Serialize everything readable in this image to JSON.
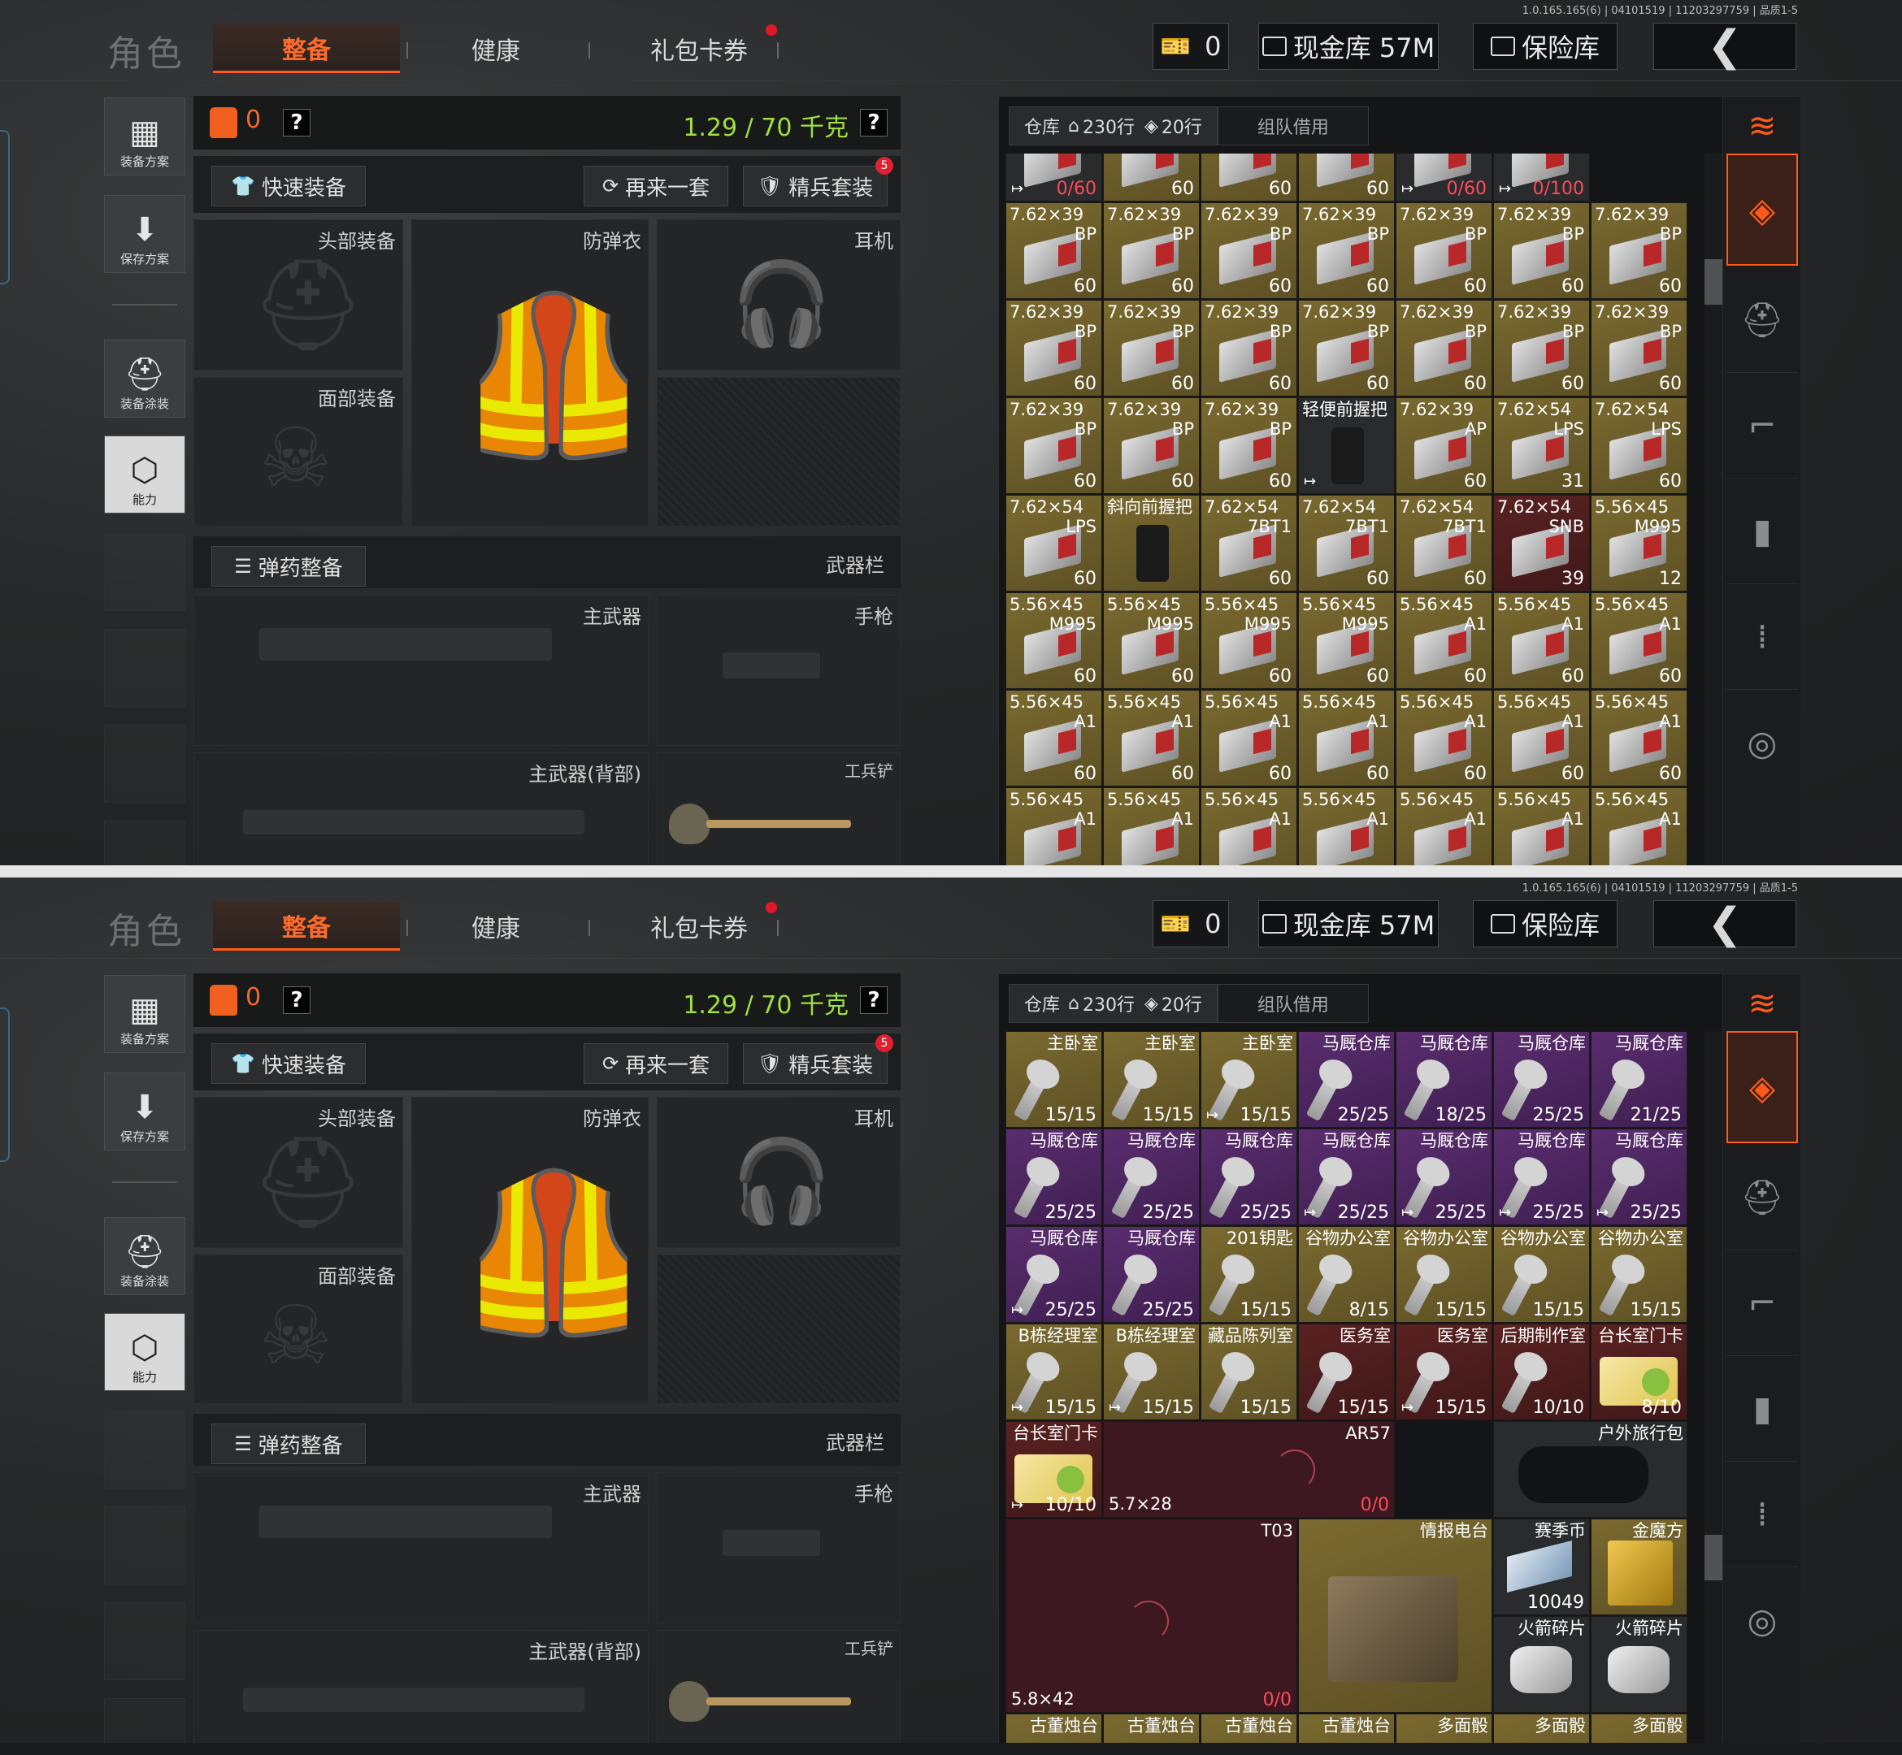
{
  "version": "1.0.165.165(6) | 04101519 | 11203297759 | 品质1-5",
  "nav": {
    "role": "角色",
    "tabs": [
      "整备",
      "健康",
      "礼包卡券"
    ]
  },
  "header": {
    "ticket_count": "0",
    "cash_label": "现金库 57M",
    "safe_label": "保险库",
    "back_icon": "back-arrow-icon"
  },
  "left_nav": {
    "items": [
      "装备方案",
      "保存方案",
      "装备涂装",
      "能力"
    ]
  },
  "equip": {
    "vest_count": "0",
    "weight": "1.29 / 70 千克",
    "quick_equip": "快速装备",
    "retry": "再来一套",
    "elite": "精兵套装",
    "elite_badge": "5",
    "slots": {
      "head": "头部装备",
      "armor": "防弹衣",
      "ear": "耳机",
      "face": "面部装备"
    },
    "ammo_label": "弹药整备",
    "weapon_bar": "武器栏",
    "weapon_slots": {
      "primary": "主武器",
      "pistol": "手枪",
      "primary_back": "主武器(背部)",
      "melee": "工兵铲"
    }
  },
  "inventory": {
    "tab_warehouse": "仓库",
    "rows_home": "230行",
    "rows_extra": "20行",
    "tab_team": "组队借用",
    "colors": {
      "accent": "#ff5a1a",
      "green": "#9fe040",
      "red": "#ff4a5a"
    }
  },
  "grid1": [
    {
      "r": 0,
      "c": 0,
      "nm": "",
      "sub": "",
      "cnt": "0/60",
      "bg": "dark",
      "red": true,
      "mk": "↦",
      "ico": "box"
    },
    {
      "r": 0,
      "c": 1,
      "nm": "",
      "sub": "",
      "cnt": "60",
      "bg": "gold",
      "ico": "box"
    },
    {
      "r": 0,
      "c": 2,
      "nm": "",
      "sub": "",
      "cnt": "60",
      "bg": "gold",
      "ico": "box"
    },
    {
      "r": 0,
      "c": 3,
      "nm": "",
      "sub": "",
      "cnt": "60",
      "bg": "gold",
      "ico": "box"
    },
    {
      "r": 0,
      "c": 4,
      "nm": "",
      "sub": "",
      "cnt": "0/60",
      "bg": "dark",
      "red": true,
      "mk": "↦",
      "ico": "box"
    },
    {
      "r": 0,
      "c": 5,
      "nm": "",
      "sub": "",
      "cnt": "0/100",
      "bg": "dark",
      "red": true,
      "mk": "↦",
      "ico": "box"
    },
    {
      "r": 1,
      "c": 0,
      "nm": "7.62×39",
      "sub": "BP",
      "cnt": "60",
      "bg": "gold",
      "ico": "box"
    },
    {
      "r": 1,
      "c": 1,
      "nm": "7.62×39",
      "sub": "BP",
      "cnt": "60",
      "bg": "gold",
      "ico": "box"
    },
    {
      "r": 1,
      "c": 2,
      "nm": "7.62×39",
      "sub": "BP",
      "cnt": "60",
      "bg": "gold",
      "ico": "box"
    },
    {
      "r": 1,
      "c": 3,
      "nm": "7.62×39",
      "sub": "BP",
      "cnt": "60",
      "bg": "gold",
      "ico": "box"
    },
    {
      "r": 1,
      "c": 4,
      "nm": "7.62×39",
      "sub": "BP",
      "cnt": "60",
      "bg": "gold",
      "ico": "box"
    },
    {
      "r": 1,
      "c": 5,
      "nm": "7.62×39",
      "sub": "BP",
      "cnt": "60",
      "bg": "gold",
      "ico": "box"
    },
    {
      "r": 1,
      "c": 6,
      "nm": "7.62×39",
      "sub": "BP",
      "cnt": "60",
      "bg": "gold",
      "ico": "box"
    },
    {
      "r": 2,
      "c": 0,
      "nm": "7.62×39",
      "sub": "BP",
      "cnt": "60",
      "bg": "gold",
      "ico": "box"
    },
    {
      "r": 2,
      "c": 1,
      "nm": "7.62×39",
      "sub": "BP",
      "cnt": "60",
      "bg": "gold",
      "ico": "box"
    },
    {
      "r": 2,
      "c": 2,
      "nm": "7.62×39",
      "sub": "BP",
      "cnt": "60",
      "bg": "gold",
      "ico": "box"
    },
    {
      "r": 2,
      "c": 3,
      "nm": "7.62×39",
      "sub": "BP",
      "cnt": "60",
      "bg": "gold",
      "ico": "box"
    },
    {
      "r": 2,
      "c": 4,
      "nm": "7.62×39",
      "sub": "BP",
      "cnt": "60",
      "bg": "gold",
      "ico": "box"
    },
    {
      "r": 2,
      "c": 5,
      "nm": "7.62×39",
      "sub": "BP",
      "cnt": "60",
      "bg": "gold",
      "ico": "box"
    },
    {
      "r": 2,
      "c": 6,
      "nm": "7.62×39",
      "sub": "BP",
      "cnt": "60",
      "bg": "gold",
      "ico": "box"
    },
    {
      "r": 3,
      "c": 0,
      "nm": "7.62×39",
      "sub": "BP",
      "cnt": "60",
      "bg": "gold",
      "ico": "box"
    },
    {
      "r": 3,
      "c": 1,
      "nm": "7.62×39",
      "sub": "BP",
      "cnt": "60",
      "bg": "gold",
      "ico": "box"
    },
    {
      "r": 3,
      "c": 2,
      "nm": "7.62×39",
      "sub": "BP",
      "cnt": "60",
      "bg": "gold",
      "ico": "box"
    },
    {
      "r": 3,
      "c": 3,
      "nm": "轻便前握把",
      "sub": "",
      "cnt": "",
      "bg": "dark",
      "mk": "↦",
      "ico": "grip"
    },
    {
      "r": 3,
      "c": 4,
      "nm": "7.62×39",
      "sub": "AP",
      "cnt": "60",
      "bg": "gold",
      "ico": "box"
    },
    {
      "r": 3,
      "c": 5,
      "nm": "7.62×54",
      "sub": "LPS",
      "cnt": "31",
      "bg": "gold",
      "ico": "box"
    },
    {
      "r": 3,
      "c": 6,
      "nm": "7.62×54",
      "sub": "LPS",
      "cnt": "60",
      "bg": "gold",
      "ico": "box"
    },
    {
      "r": 4,
      "c": 0,
      "nm": "7.62×54",
      "sub": "LPS",
      "cnt": "60",
      "bg": "gold",
      "ico": "box"
    },
    {
      "r": 4,
      "c": 1,
      "nm": "斜向前握把",
      "sub": "",
      "cnt": "",
      "bg": "gold",
      "ico": "grip"
    },
    {
      "r": 4,
      "c": 2,
      "nm": "7.62×54",
      "sub": "7BT1",
      "cnt": "60",
      "bg": "gold",
      "ico": "box"
    },
    {
      "r": 4,
      "c": 3,
      "nm": "7.62×54",
      "sub": "7BT1",
      "cnt": "60",
      "bg": "gold",
      "ico": "box"
    },
    {
      "r": 4,
      "c": 4,
      "nm": "7.62×54",
      "sub": "7BT1",
      "cnt": "60",
      "bg": "gold",
      "ico": "box"
    },
    {
      "r": 4,
      "c": 5,
      "nm": "7.62×54",
      "sub": "SNB",
      "cnt": "39",
      "bg": "red",
      "ico": "box"
    },
    {
      "r": 4,
      "c": 6,
      "nm": "5.56×45",
      "sub": "M995",
      "cnt": "12",
      "bg": "gold",
      "ico": "box"
    },
    {
      "r": 5,
      "c": 0,
      "nm": "5.56×45",
      "sub": "M995",
      "cnt": "60",
      "bg": "gold",
      "ico": "box"
    },
    {
      "r": 5,
      "c": 1,
      "nm": "5.56×45",
      "sub": "M995",
      "cnt": "60",
      "bg": "gold",
      "ico": "box"
    },
    {
      "r": 5,
      "c": 2,
      "nm": "5.56×45",
      "sub": "M995",
      "cnt": "60",
      "bg": "gold",
      "ico": "box"
    },
    {
      "r": 5,
      "c": 3,
      "nm": "5.56×45",
      "sub": "M995",
      "cnt": "60",
      "bg": "gold",
      "ico": "box"
    },
    {
      "r": 5,
      "c": 4,
      "nm": "5.56×45",
      "sub": "A1",
      "cnt": "60",
      "bg": "gold",
      "ico": "box"
    },
    {
      "r": 5,
      "c": 5,
      "nm": "5.56×45",
      "sub": "A1",
      "cnt": "60",
      "bg": "gold",
      "ico": "box"
    },
    {
      "r": 5,
      "c": 6,
      "nm": "5.56×45",
      "sub": "A1",
      "cnt": "60",
      "bg": "gold",
      "ico": "box"
    },
    {
      "r": 6,
      "c": 0,
      "nm": "5.56×45",
      "sub": "A1",
      "cnt": "60",
      "bg": "gold",
      "ico": "box"
    },
    {
      "r": 6,
      "c": 1,
      "nm": "5.56×45",
      "sub": "A1",
      "cnt": "60",
      "bg": "gold",
      "ico": "box"
    },
    {
      "r": 6,
      "c": 2,
      "nm": "5.56×45",
      "sub": "A1",
      "cnt": "60",
      "bg": "gold",
      "ico": "box"
    },
    {
      "r": 6,
      "c": 3,
      "nm": "5.56×45",
      "sub": "A1",
      "cnt": "60",
      "bg": "gold",
      "ico": "box"
    },
    {
      "r": 6,
      "c": 4,
      "nm": "5.56×45",
      "sub": "A1",
      "cnt": "60",
      "bg": "gold",
      "ico": "box"
    },
    {
      "r": 6,
      "c": 5,
      "nm": "5.56×45",
      "sub": "A1",
      "cnt": "60",
      "bg": "gold",
      "ico": "box"
    },
    {
      "r": 6,
      "c": 6,
      "nm": "5.56×45",
      "sub": "A1",
      "cnt": "60",
      "bg": "gold",
      "ico": "box"
    },
    {
      "r": 7,
      "c": 0,
      "nm": "5.56×45",
      "sub": "A1",
      "cnt": "",
      "bg": "gold",
      "ico": "box"
    },
    {
      "r": 7,
      "c": 1,
      "nm": "5.56×45",
      "sub": "A1",
      "cnt": "",
      "bg": "gold",
      "ico": "box"
    },
    {
      "r": 7,
      "c": 2,
      "nm": "5.56×45",
      "sub": "A1",
      "cnt": "",
      "bg": "gold",
      "ico": "box"
    },
    {
      "r": 7,
      "c": 3,
      "nm": "5.56×45",
      "sub": "A1",
      "cnt": "",
      "bg": "gold",
      "ico": "box"
    },
    {
      "r": 7,
      "c": 4,
      "nm": "5.56×45",
      "sub": "A1",
      "cnt": "",
      "bg": "gold",
      "ico": "box"
    },
    {
      "r": 7,
      "c": 5,
      "nm": "5.56×45",
      "sub": "A1",
      "cnt": "",
      "bg": "gold",
      "ico": "box"
    },
    {
      "r": 7,
      "c": 6,
      "nm": "5.56×45",
      "sub": "A1",
      "cnt": "",
      "bg": "gold",
      "ico": "box"
    }
  ],
  "grid2": [
    {
      "r": 0,
      "c": 0,
      "nm": "主卧室",
      "cnt": "15/15",
      "bg": "gold",
      "ico": "key"
    },
    {
      "r": 0,
      "c": 1,
      "nm": "主卧室",
      "cnt": "15/15",
      "bg": "gold",
      "ico": "key"
    },
    {
      "r": 0,
      "c": 2,
      "nm": "主卧室",
      "cnt": "15/15",
      "bg": "gold",
      "mk": "↦",
      "ico": "key"
    },
    {
      "r": 0,
      "c": 3,
      "nm": "马厩仓库",
      "cnt": "25/25",
      "bg": "purple",
      "ico": "key"
    },
    {
      "r": 0,
      "c": 4,
      "nm": "马厩仓库",
      "cnt": "18/25",
      "bg": "purple",
      "ico": "key"
    },
    {
      "r": 0,
      "c": 5,
      "nm": "马厩仓库",
      "cnt": "25/25",
      "bg": "purple",
      "ico": "key"
    },
    {
      "r": 0,
      "c": 6,
      "nm": "马厩仓库",
      "cnt": "21/25",
      "bg": "purple",
      "ico": "key"
    },
    {
      "r": 1,
      "c": 0,
      "nm": "马厩仓库",
      "cnt": "25/25",
      "bg": "purple",
      "ico": "key"
    },
    {
      "r": 1,
      "c": 1,
      "nm": "马厩仓库",
      "cnt": "25/25",
      "bg": "purple",
      "ico": "key"
    },
    {
      "r": 1,
      "c": 2,
      "nm": "马厩仓库",
      "cnt": "25/25",
      "bg": "purple",
      "ico": "key"
    },
    {
      "r": 1,
      "c": 3,
      "nm": "马厩仓库",
      "cnt": "25/25",
      "bg": "purple",
      "mk": "↦",
      "ico": "key"
    },
    {
      "r": 1,
      "c": 4,
      "nm": "马厩仓库",
      "cnt": "25/25",
      "bg": "purple",
      "mk": "↦",
      "ico": "key"
    },
    {
      "r": 1,
      "c": 5,
      "nm": "马厩仓库",
      "cnt": "25/25",
      "bg": "purple",
      "mk": "↦",
      "ico": "key"
    },
    {
      "r": 1,
      "c": 6,
      "nm": "马厩仓库",
      "cnt": "25/25",
      "bg": "purple",
      "mk": "↦",
      "ico": "key"
    },
    {
      "r": 2,
      "c": 0,
      "nm": "马厩仓库",
      "cnt": "25/25",
      "bg": "purple",
      "mk": "↦",
      "ico": "key"
    },
    {
      "r": 2,
      "c": 1,
      "nm": "马厩仓库",
      "cnt": "25/25",
      "bg": "purple",
      "ico": "key"
    },
    {
      "r": 2,
      "c": 2,
      "nm": "201钥匙",
      "cnt": "15/15",
      "bg": "gold",
      "ico": "key"
    },
    {
      "r": 2,
      "c": 3,
      "nm": "谷物办公室",
      "cnt": "8/15",
      "bg": "gold",
      "ico": "key"
    },
    {
      "r": 2,
      "c": 4,
      "nm": "谷物办公室",
      "cnt": "15/15",
      "bg": "gold",
      "ico": "key"
    },
    {
      "r": 2,
      "c": 5,
      "nm": "谷物办公室",
      "cnt": "15/15",
      "bg": "gold",
      "ico": "key"
    },
    {
      "r": 2,
      "c": 6,
      "nm": "谷物办公室",
      "cnt": "15/15",
      "bg": "gold",
      "ico": "key"
    },
    {
      "r": 3,
      "c": 0,
      "nm": "B栋经理室",
      "cnt": "15/15",
      "bg": "gold",
      "mk": "↦",
      "ico": "key"
    },
    {
      "r": 3,
      "c": 1,
      "nm": "B栋经理室",
      "cnt": "15/15",
      "bg": "gold",
      "mk": "↦",
      "ico": "key"
    },
    {
      "r": 3,
      "c": 2,
      "nm": "藏品陈列室",
      "cnt": "15/15",
      "bg": "gold",
      "ico": "key"
    },
    {
      "r": 3,
      "c": 3,
      "nm": "医务室",
      "cnt": "15/15",
      "bg": "red",
      "ico": "key"
    },
    {
      "r": 3,
      "c": 4,
      "nm": "医务室",
      "cnt": "15/15",
      "bg": "red",
      "mk": "↦",
      "ico": "key"
    },
    {
      "r": 3,
      "c": 5,
      "nm": "后期制作室",
      "cnt": "10/10",
      "bg": "red",
      "ico": "key"
    },
    {
      "r": 3,
      "c": 6,
      "nm": "台长室门卡",
      "cnt": "8/10",
      "bg": "red",
      "ico": "card"
    },
    {
      "r": 4,
      "c": 0,
      "nm": "台长室门卡",
      "cnt": "10/10",
      "bg": "red",
      "mk": "↦",
      "ico": "card"
    }
  ],
  "grid2_big": {
    "mag1": {
      "nm": "AR57",
      "cnt": "0/0",
      "cal": "5.7×28"
    },
    "bag": {
      "nm": "户外旅行包"
    },
    "mag2": {
      "nm": "T03",
      "cnt": "0/0",
      "cal": "5.8×42"
    },
    "radio": {
      "nm": "情报电台"
    },
    "coin": {
      "nm": "赛季币",
      "cnt": "10049"
    },
    "cube": {
      "nm": "金魔方"
    },
    "rocket1": {
      "nm": "火箭碎片"
    },
    "rocket2": {
      "nm": "火箭碎片"
    },
    "bottom": [
      "古董烛台",
      "古董烛台",
      "古董烛台",
      "古董烛台",
      "多面骰",
      "多面骰",
      "多面骰"
    ]
  }
}
